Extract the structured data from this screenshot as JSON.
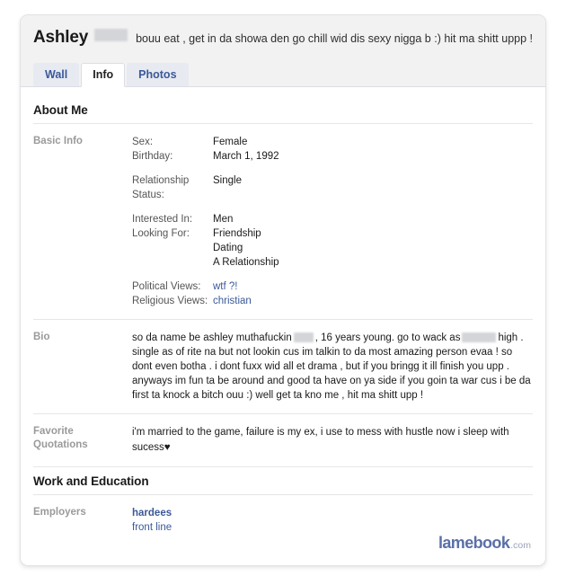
{
  "profile": {
    "name": "Ashley",
    "name_censored": "[redacted]",
    "status": "bouu eat , get in da showa den go chill wid dis sexy nigga b :) hit ma shitt uppp !",
    "tabs": [
      {
        "label": "Wall",
        "active": false
      },
      {
        "label": "Info",
        "active": true
      },
      {
        "label": "Photos",
        "active": false
      }
    ]
  },
  "about": {
    "heading": "About Me",
    "basic_info": {
      "label": "Basic Info",
      "group1": [
        {
          "key": "Sex:",
          "value": "Female"
        },
        {
          "key": "Birthday:",
          "value": "March 1, 1992"
        }
      ],
      "group2": [
        {
          "key": "Relationship Status:",
          "value": "Single"
        }
      ],
      "group3": {
        "interested_in_key": "Interested In:",
        "interested_in_value": "Men",
        "looking_for_key": "Looking For:",
        "looking_for_values": [
          "Friendship",
          "Dating",
          "A Relationship"
        ]
      },
      "group4": [
        {
          "key": "Political Views:",
          "value": "wtf ?!"
        },
        {
          "key": "Religious Views:",
          "value": "christian"
        }
      ]
    },
    "bio": {
      "label": "Bio",
      "part1": "so da name be ashley muthafuckin",
      "censor1": "[redacted]",
      "part2": ", 16 years young. go to wack as",
      "censor2": "[redacted]",
      "part3": "high . single as of rite na but not lookin cus im talkin to da most amazing person evaa ! so dont even botha . i dont fuxx wid all et drama , but if you bringg it ill finish you upp . anyways im fun ta be around and good ta have on ya side if you goin ta war cus i be da first ta knock a bitch ouu :) well get ta kno me , hit ma shitt upp !"
    },
    "quotations": {
      "label_line1": "Favorite",
      "label_line2": "Quotations",
      "text": "i'm married to the game, failure is my ex, i use to mess with hustle now i sleep with sucess",
      "heart": "♥"
    }
  },
  "work": {
    "heading": "Work and Education",
    "employers": {
      "label": "Employers",
      "name": "hardees",
      "role": "front line"
    }
  },
  "watermark": {
    "main": "lamebook",
    "tld": ".com"
  },
  "colors": {
    "link": "#3b5998",
    "header_bg": "#f2f2f3",
    "label_gray": "#9a9a9a",
    "watermark": "#5a6fa8"
  }
}
